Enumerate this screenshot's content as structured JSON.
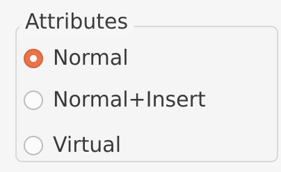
{
  "group": {
    "title": "Attributes",
    "options": [
      {
        "label": "Normal",
        "checked": true
      },
      {
        "label": "Normal+Insert",
        "checked": false
      },
      {
        "label": "Virtual",
        "checked": false
      }
    ]
  },
  "colors": {
    "accent": "#e9744a",
    "border": "#d9d9d9",
    "background": "#f6f6f6"
  }
}
